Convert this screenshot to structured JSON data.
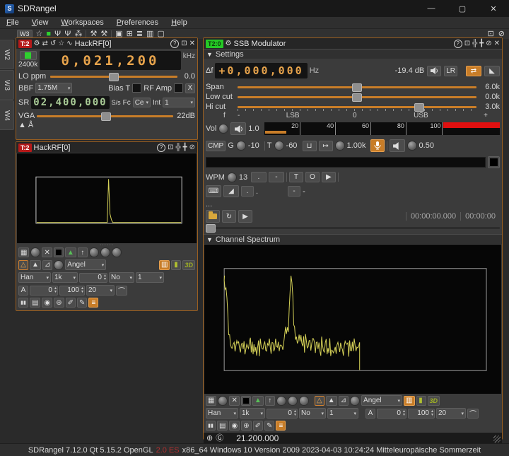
{
  "window": {
    "title": "SDRangel"
  },
  "window_controls": {
    "minimize": "—",
    "maximize": "▢",
    "close": "✕"
  },
  "menubar": {
    "items": [
      "File",
      "View",
      "Workspaces",
      "Preferences",
      "Help"
    ]
  },
  "toolbar": {
    "workspace": "W3"
  },
  "workspace_tabs": {
    "w2": "W2",
    "w3": "W3",
    "w4": "W4"
  },
  "icons": {
    "app": "S",
    "star": "☆",
    "power": "■",
    "tx": "Ψ",
    "rx": "Ψ",
    "feature": "⁂",
    "wrench": "⚒",
    "cascade": "▣",
    "tile": "⊞",
    "stack": "≣",
    "vtile": "▥",
    "newwin": "▢",
    "restore": "⊡",
    "block": "⊘",
    "gear": "⚙",
    "swap": "⇄",
    "reload": "↺",
    "graph": "∿",
    "help": "?",
    "popout": "⊡",
    "shrink": "╬",
    "expand": "╋",
    "hide": "⊘",
    "close": "✕",
    "grid": "▦",
    "dot": "●",
    "cut": "✕",
    "blacksq": "■",
    "filltri": "▲",
    "maxhold": "↑",
    "tri_o": "△",
    "tri_f": "▲",
    "tri_l": "⊿",
    "hist": "▥",
    "bars": "▮",
    "pause": "▮▮",
    "save": "▤",
    "record": "◉",
    "cross": "⊕",
    "ruler": "✐",
    "pen": "✎",
    "list": "≡",
    "curve": "⌒",
    "dd": "▾",
    "up": "▴",
    "down": "▾",
    "corner": "◣",
    "filter": "⊔",
    "squelch": "↦",
    "play": "▶",
    "keyboard": "⌨",
    "morse": "◢",
    "loop": "↻",
    "zoom_in": "⊕",
    "zoom_reset": "Ⓖ",
    "antenna": "Å"
  },
  "device": {
    "badge": "T:2",
    "title": "HackRF[0]",
    "rate_label": "2400k",
    "frequency": "0,021,200",
    "freq_unit": "kHz",
    "lo_ppm": "LO ppm",
    "lo_ppm_value": "0.0",
    "bbf": "BBF",
    "bbf_value": "1.75M",
    "bias": "Bias T",
    "rf_amp": "RF Amp",
    "x": "X",
    "sr": "SR",
    "sr_value": "02,400,000",
    "sr_unit": "S/s",
    "fc": "Fc",
    "fc_value": "Ce",
    "int": "Int",
    "int_value": "1",
    "vga": "VGA",
    "vga_value": "22dB"
  },
  "minispec": {
    "badge": "T:2",
    "title": "HackRF[0]"
  },
  "spec_controls": {
    "style": "Angel",
    "window": "Han",
    "fft": "1k",
    "offset": "0",
    "avg_mode": "No",
    "avg_count": "1",
    "auto": "A",
    "ref": "0",
    "range": "100",
    "decay": "20",
    "threeD": "3D"
  },
  "ssb": {
    "badge": "T2:0",
    "title": "SSB Modulator",
    "settings": "Settings",
    "df_label": "Δf",
    "df_value": "+0,000,000",
    "df_unit": "Hz",
    "power": "-19.4 dB",
    "lr": "LR",
    "span": "Span",
    "span_value": "6.0k",
    "low_cut": "Low cut",
    "low_cut_value": "0.0k",
    "hi_cut": "Hi cut",
    "hi_cut_value": "3.0k",
    "f": "f",
    "minus": "-",
    "lsb": "LSB",
    "zero": "0",
    "usb": "USB",
    "plus": "+",
    "vol": "Vol",
    "vol_value": "1.0",
    "meter_ticks": [
      "20",
      "40",
      "60",
      "80",
      "100"
    ],
    "cmp": "CMP",
    "g": "G",
    "g_value": "-10",
    "t": "T",
    "t_value": "-60",
    "bw_value": "1.00k",
    "mix_value": "0.50",
    "wpm": "WPM",
    "wpm_value": "13",
    "dot": ".",
    "dash": "-",
    "t_btn": "T",
    "loop_btn": "O",
    "file": "...",
    "time_pos": "00:00:00.000",
    "time_len": "00:00:00",
    "channel_spectrum": "Channel Spectrum",
    "frequency": "21.200.000"
  },
  "statusbar": {
    "pre": "SDRangel 7.12.0 Qt 5.15.2 OpenGL",
    "gl": "2.0 ES",
    "post": "x86_64 Windows 10 Version 2009 2023-04-03 10:24:24 Mitteleuropäische Sommerzeit"
  },
  "colors": {
    "accent": "#c87d28",
    "digit_orange": "#e8a44c",
    "digit_green": "#a8ca96",
    "badge_red": "#b51a1a",
    "badge_green": "#25c825",
    "meter_red": "#e01010",
    "trace": "#d6d258"
  },
  "spectra": {
    "mini": {
      "frame": {
        "x0": 0.106,
        "x1": 0.918,
        "y0": 0.262,
        "y1": 0.778
      },
      "peak_x": 0.514,
      "peak_top": 0.286
    },
    "channel": {
      "frame": {
        "x0": 0.067,
        "x1": 0.95,
        "y0": 0.16,
        "y1": 0.845
      },
      "seed": 7,
      "floor": 0.66,
      "noise": 0.055,
      "peak_x": 0.293,
      "peak_top": 0.26,
      "end_x": 0.523
    }
  }
}
